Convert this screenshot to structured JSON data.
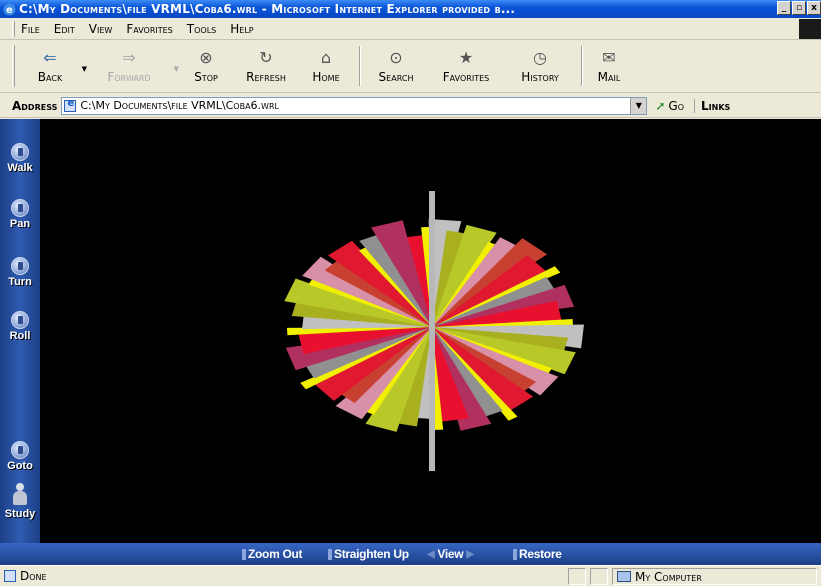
{
  "window": {
    "title": "C:\\My Documents\\file VRML\\Coba6.wrl - Microsoft Internet Explorer provided b...",
    "buttons": [
      "_",
      "▫",
      "x"
    ]
  },
  "menu": [
    {
      "label": "File"
    },
    {
      "label": "Edit"
    },
    {
      "label": "View"
    },
    {
      "label": "Favorites"
    },
    {
      "label": "Tools"
    },
    {
      "label": "Help"
    }
  ],
  "toolbar": {
    "back": "Back",
    "forward": "Forward",
    "stop": "Stop",
    "refresh": "Refresh",
    "home": "Home",
    "search": "Search",
    "favorites": "Favorites",
    "history": "History",
    "mail": "Mail"
  },
  "address": {
    "label": "Address",
    "value": "C:\\My Documents\\file VRML\\Coba6.wrl",
    "go": "Go",
    "links": "Links"
  },
  "vrml_nav": {
    "walk": "Walk",
    "pan": "Pan",
    "turn": "Turn",
    "roll": "Roll",
    "goto": "Goto",
    "study": "Study"
  },
  "vrml_bottom": {
    "zoom_out": "Zoom Out",
    "straighten_up": "Straighten Up",
    "view": "View",
    "restore": "Restore"
  },
  "scene": {
    "background": "#000000",
    "blade_colors": [
      "#e8102e",
      "#d02048",
      "#c0c0c0",
      "#a8b020",
      "#b8c828",
      "#e8e8c0",
      "#d890a8",
      "#c84030",
      "#e01830",
      "#f0f000",
      "#909090",
      "#b03060"
    ]
  },
  "status": {
    "text": "Done",
    "zone": "My Computer"
  }
}
